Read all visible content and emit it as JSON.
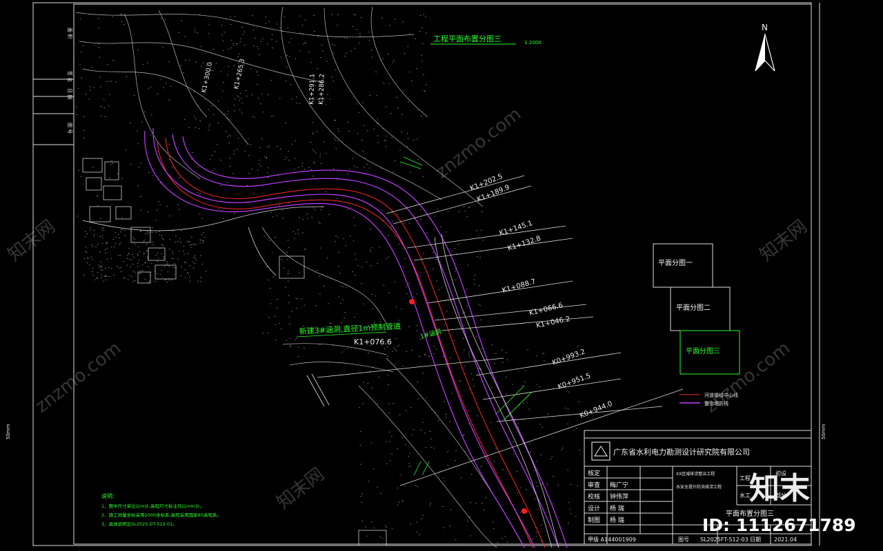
{
  "drawing": {
    "title": "工程平面布置分图三",
    "scale": "1:2000",
    "north": "N"
  },
  "chainage_labels": [
    "K1+202.5",
    "K1+189.9",
    "K1+145.1",
    "K1+132.8",
    "K1+088.7",
    "K1+066.6",
    "K1+046.2",
    "K1+076.6",
    "K0+993.2",
    "K0+951.5",
    "K0+944.0"
  ],
  "top_labels": [
    "K1+300.0",
    "K1+265.3",
    "K1+291.1",
    "K1+286.2"
  ],
  "annotations": {
    "culvert_note": "新建3#涵洞,直径1m预制管道",
    "culvert_label": "1#涵洞"
  },
  "key_plan": {
    "sheets": [
      "平面分图一",
      "平面分图二",
      "平面分图三"
    ]
  },
  "legend": {
    "items": [
      "河道堤线中心线",
      "整治堤防线"
    ]
  },
  "notes": {
    "title": "说明:",
    "lines": [
      "1、图中尺寸单位以m计,高程尺寸标注均以mm计。",
      "2、施工测量坐标采用2000坐标系,高程采用国家85高程系。",
      "3、具体说明见SL2025 DT-512-01。"
    ]
  },
  "title_block": {
    "company": "广东省水利电力勘测设计研究院有限公司",
    "rows": [
      {
        "label": "核定",
        "name": ""
      },
      {
        "label": "审查",
        "name": "梅广宁"
      },
      {
        "label": "校核",
        "name": "钟伟萍"
      },
      {
        "label": "设计",
        "name": "杨 瑞"
      },
      {
        "label": "制图",
        "name": "杨 瑞"
      }
    ],
    "project_line1": "XX区域排涝整治工程",
    "project_line2": "水安全提升防洪排涝工程",
    "stage_label": "工程",
    "design_stage": "初设",
    "part_label": "水工",
    "part_value": "部分",
    "sheet_title": "平面布置分图三",
    "cert_label": "甲级 A144001909",
    "drawing_no_label": "图号",
    "drawing_no": "SL2025FT-512-03",
    "date_label": "日期",
    "date": "2021.04"
  },
  "side_labels": [
    "面 积",
    "签 名",
    "日 期",
    "图 号"
  ],
  "border_dim": "50mm",
  "watermark": {
    "text": "znzmo.com",
    "brand": "知末网",
    "logo": "知末",
    "id": "ID: 1112671789"
  },
  "colors": {
    "background": "#000000",
    "road": "#c040ff",
    "center": "#ff2a2a",
    "annotation": "#2bff2b",
    "linework": "#d9d9d9"
  }
}
